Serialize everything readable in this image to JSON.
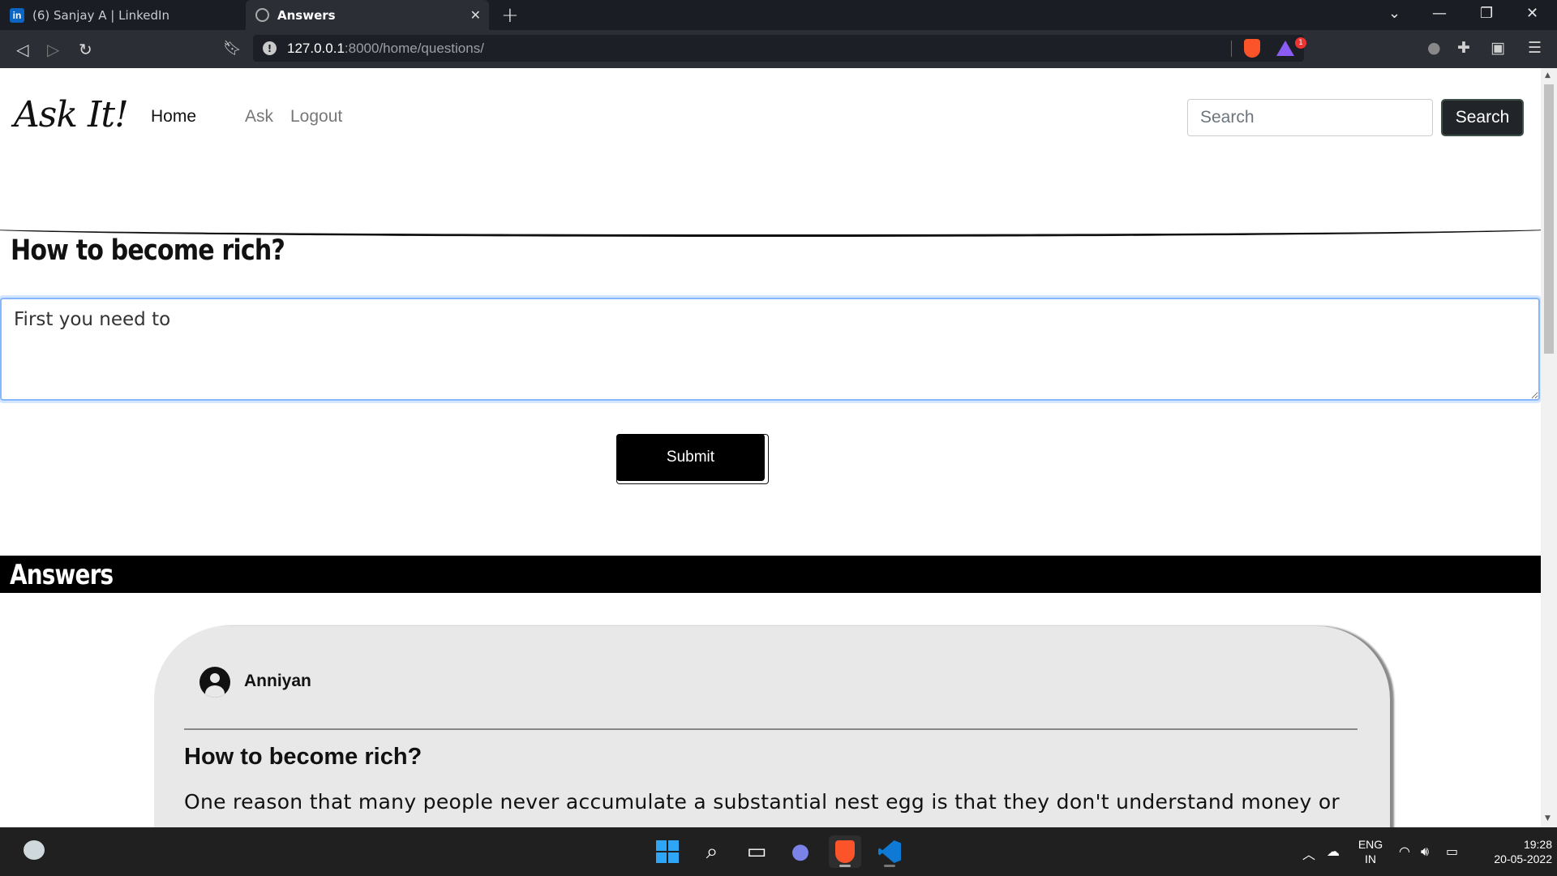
{
  "browser": {
    "tabs": [
      {
        "label": "(6) Sanjay A | LinkedIn",
        "favicon": "linkedin-icon"
      },
      {
        "label": "Answers",
        "favicon": "globe-icon",
        "active": true
      }
    ],
    "url_host": "127.0.0.1",
    "url_rest": ":8000/home/questions/",
    "rewards_badge": "1"
  },
  "nav": {
    "brand": "Ask It!",
    "links": [
      "Home",
      "Ask",
      "Logout"
    ],
    "search_placeholder": "Search",
    "search_button": "Search"
  },
  "question": {
    "title": "How to become rich?",
    "answer_value": "First you need to",
    "submit_label": "Submit"
  },
  "answers": {
    "heading": "Answers",
    "items": [
      {
        "user": "Anniyan",
        "question": "How to become rich?",
        "text": "One reason that many people never accumulate a substantial nest egg is that they don't understand money or how it works. This is just one of the reasons that the children and grandchildren of the wealthy become so well-off."
      }
    ]
  },
  "taskbar": {
    "lang": "ENG",
    "region": "IN",
    "time": "19:28",
    "date": "20-05-2022"
  }
}
